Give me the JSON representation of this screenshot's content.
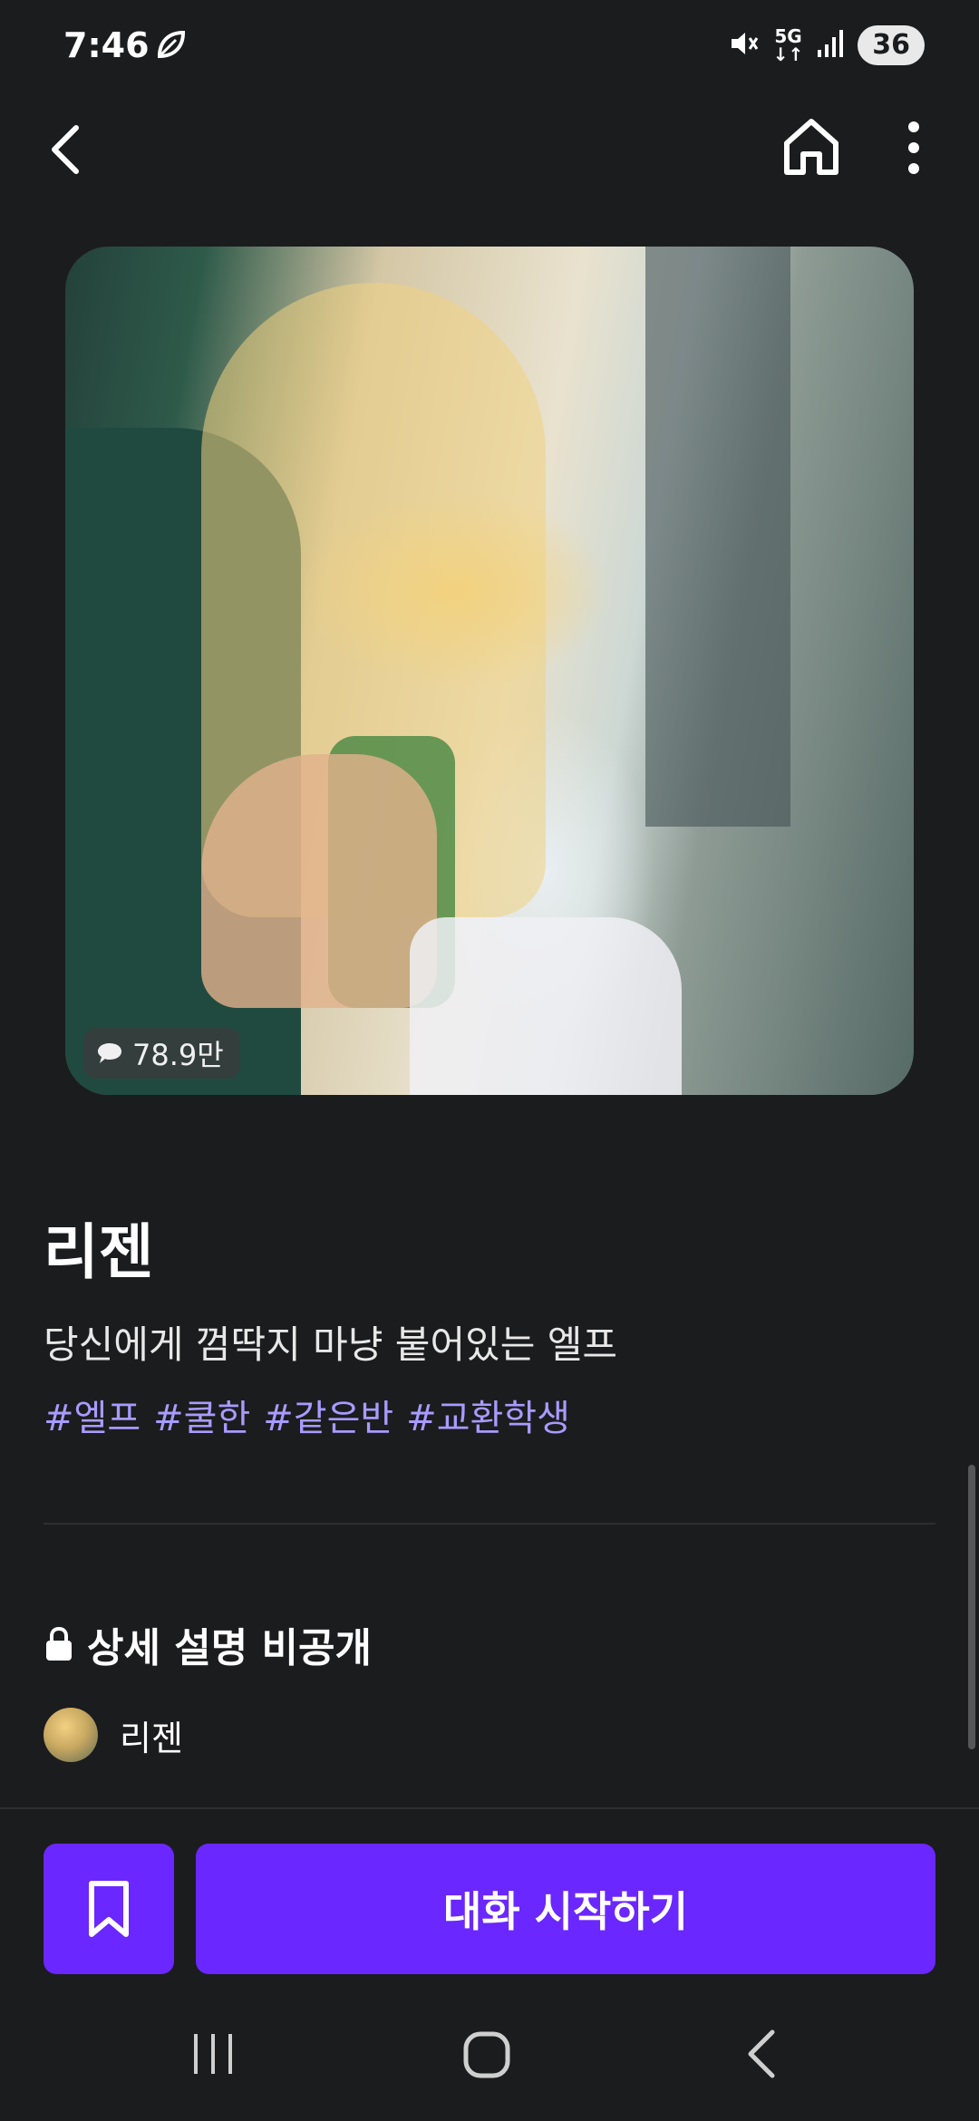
{
  "status_bar": {
    "time": "7:46",
    "battery": "36",
    "network": "5G",
    "icons": [
      "leaf-icon",
      "mute-icon",
      "5g-icon",
      "signal-icon",
      "battery-icon"
    ]
  },
  "app_bar": {
    "icons": [
      "back-arrow-icon",
      "home-icon",
      "more-vert-icon"
    ]
  },
  "character": {
    "chat_count": "78.9만",
    "name": "리젠",
    "description": "당신에게 껌딱지 마냥 붙어있는 엘프",
    "tags": [
      "#엘프",
      "#쿨한",
      "#같은반",
      "#교환학생"
    ],
    "detail_status": "상세 설명 비공개",
    "creator_name": "리젠"
  },
  "actions": {
    "start_chat": "대화 시작하기"
  },
  "colors": {
    "background": "#1b1c1d",
    "accent": "#6a27ff",
    "tag": "#a79bff"
  }
}
